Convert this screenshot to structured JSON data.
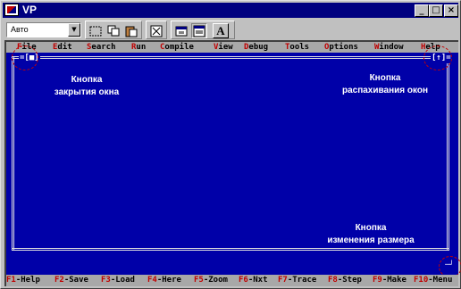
{
  "window": {
    "title": "VP",
    "caption_buttons": {
      "minimize_icon": "minimize-icon",
      "maximize_icon": "maximize-icon",
      "close_icon": "close-icon"
    }
  },
  "toolbar": {
    "font_combo_value": "Авто",
    "buttons": [
      {
        "name": "mark-text-button",
        "icon": "dashed-rectangle-icon"
      },
      {
        "name": "copy-button",
        "icon": "copy-icon"
      },
      {
        "name": "paste-button",
        "icon": "paste-icon"
      },
      {
        "name": "fullscreen-button",
        "icon": "fullscreen-icon"
      },
      {
        "name": "properties-button",
        "icon": "properties-icon"
      },
      {
        "name": "background-button",
        "icon": "background-icon"
      },
      {
        "name": "font-button",
        "label": "A"
      }
    ]
  },
  "menubar": {
    "items": [
      {
        "hot": "F",
        "rest": "ile"
      },
      {
        "hot": "E",
        "rest": "dit"
      },
      {
        "hot": "S",
        "rest": "earch"
      },
      {
        "hot": "R",
        "rest": "un"
      },
      {
        "hot": "C",
        "rest": "ompile"
      },
      {
        "hot": "V",
        "rest": "iew"
      },
      {
        "hot": "D",
        "rest": "ebug"
      },
      {
        "hot": "T",
        "rest": "ools"
      },
      {
        "hot": "O",
        "rest": "ptions"
      },
      {
        "hot": "W",
        "rest": "indow"
      },
      {
        "hot": "H",
        "rest": "elp"
      }
    ]
  },
  "editor_window": {
    "close_control": "=[■]",
    "zoom_control": "[↑]=",
    "resize_control": "─┘"
  },
  "callouts": {
    "close": {
      "line1": "Кнопка",
      "line2": "закрытия окна"
    },
    "zoom": {
      "line1": "Кнопка",
      "line2": "распахивания окон"
    },
    "resize": {
      "line1": "Кнопка",
      "line2": "изменения размера"
    }
  },
  "statusbar": {
    "items": [
      {
        "key": "F1",
        "label": "-Help"
      },
      {
        "key": "F2",
        "label": "-Save"
      },
      {
        "key": "F3",
        "label": "-Load"
      },
      {
        "key": "F4",
        "label": "-Here"
      },
      {
        "key": "F5",
        "label": "-Zoom"
      },
      {
        "key": "F6",
        "label": "-Nxt"
      },
      {
        "key": "F7",
        "label": "-Trace"
      },
      {
        "key": "F8",
        "label": "-Step"
      },
      {
        "key": "F9",
        "label": "-Make"
      },
      {
        "key": "F10",
        "label": "-Menu"
      }
    ]
  },
  "colors": {
    "background": "#0000a8",
    "menubar": "#a8a8a8",
    "hotkey": "#c00000",
    "callout_ring": "#c80000",
    "title_bar": "#000080"
  }
}
